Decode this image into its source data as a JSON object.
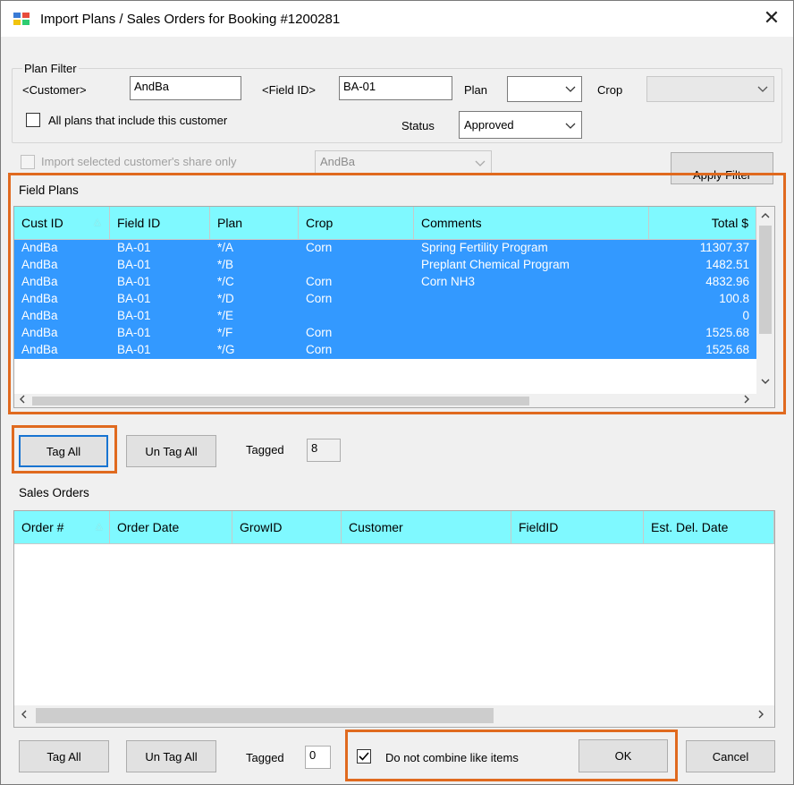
{
  "window": {
    "title": "Import Plans / Sales Orders for Booking #1200281",
    "close_glyph": "✕"
  },
  "plan_filter": {
    "group_label": "Plan Filter",
    "customer_label": "<Customer>",
    "customer_value": "AndBa",
    "field_id_label": "<Field ID>",
    "field_id_value": "BA-01",
    "plan_label": "Plan",
    "plan_value": "",
    "crop_label": "Crop",
    "crop_value": "",
    "all_plans_label": "All plans that include this customer",
    "all_plans_checked": false,
    "status_label": "Status",
    "status_value": "Approved",
    "import_share_label": "Import selected customer's share only",
    "import_share_checked": false,
    "share_customer_value": "AndBa",
    "apply_filter_label": "Apply Filter"
  },
  "field_plans": {
    "section_label": "Field Plans",
    "columns": [
      "Cust ID",
      "Field ID",
      "Plan",
      "Crop",
      "Comments",
      "Total $"
    ],
    "rows": [
      [
        "AndBa",
        "BA-01",
        "*/A",
        "Corn",
        "Spring Fertility Program",
        "11307.37"
      ],
      [
        "AndBa",
        "BA-01",
        "*/B",
        "",
        "Preplant Chemical Program",
        "1482.51"
      ],
      [
        "AndBa",
        "BA-01",
        "*/C",
        "Corn",
        "Corn NH3",
        "4832.96"
      ],
      [
        "AndBa",
        "BA-01",
        "*/D",
        "Corn",
        "",
        "100.8"
      ],
      [
        "AndBa",
        "BA-01",
        "*/E",
        "",
        "",
        "0"
      ],
      [
        "AndBa",
        "BA-01",
        "*/F",
        "Corn",
        "",
        "1525.68"
      ],
      [
        "AndBa",
        "BA-01",
        "*/G",
        "Corn",
        "",
        "1525.68"
      ]
    ],
    "tag_all_label": "Tag All",
    "untag_all_label": "Un Tag All",
    "tagged_label": "Tagged",
    "tagged_count": "8"
  },
  "sales_orders": {
    "section_label": "Sales Orders",
    "columns": [
      "Order #",
      "Order Date",
      "GrowID",
      "Customer",
      "FieldID",
      "Est. Del. Date"
    ],
    "tag_all_label": "Tag All",
    "untag_all_label": "Un Tag All",
    "tagged_label": "Tagged",
    "tagged_count": "0"
  },
  "footer": {
    "no_combine_label": "Do not combine like items",
    "no_combine_checked": true,
    "ok_label": "OK",
    "cancel_label": "Cancel"
  },
  "colors": {
    "header_bg": "#7ff9ff",
    "selected_row_bg": "#3399ff",
    "highlight_border": "#e06a1f",
    "default_button_border": "#1874d1"
  },
  "icons": {
    "app": "import-window-icon",
    "dropdown": "chevron-down-icon",
    "sort": "sort-ascending-icon"
  }
}
